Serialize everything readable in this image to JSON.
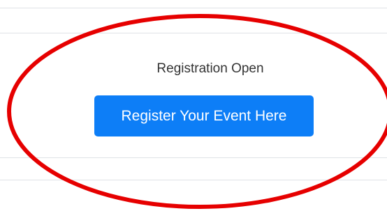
{
  "registration": {
    "status_text": "Registration Open",
    "button_label": "Register Your Event Here"
  },
  "colors": {
    "button_background": "#0d7ef7",
    "button_text": "#ffffff",
    "status_text": "#333333",
    "highlight_ring": "#e60000",
    "table_rule": "#dee2e6"
  }
}
